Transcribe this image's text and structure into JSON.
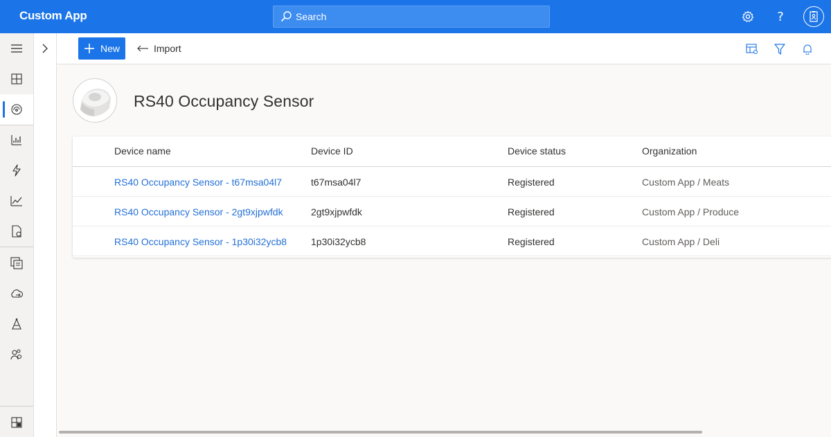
{
  "app": {
    "title": "Custom App"
  },
  "search": {
    "label": "Search"
  },
  "header_icons": [
    "settings-icon",
    "help-icon",
    "account-icon"
  ],
  "nav": {
    "items": [
      "menu-icon",
      "dashboard-icon",
      "devices-icon",
      "device-groups-icon",
      "rules-icon",
      "analytics-icon",
      "jobs-icon",
      "device-templates-icon",
      "data-export-icon",
      "device-connection-icon",
      "users-roles-icon",
      "settings-footer-icon"
    ],
    "active": "devices"
  },
  "toolbar": {
    "new_label": "New",
    "import_label": "Import",
    "right_icons": [
      "edit-columns-icon",
      "filter-icon",
      "notifications-icon"
    ]
  },
  "page": {
    "title": "RS40 Occupancy Sensor"
  },
  "table": {
    "columns": [
      "Device name",
      "Device ID",
      "Device status",
      "Organization"
    ],
    "rows": [
      {
        "name": "RS40 Occupancy Sensor - t67msa04l7",
        "id": "t67msa04l7",
        "status": "Registered",
        "org": "Custom App / Meats"
      },
      {
        "name": "RS40 Occupancy Sensor - 2gt9xjpwfdk",
        "id": "2gt9xjpwfdk",
        "status": "Registered",
        "org": "Custom App / Produce"
      },
      {
        "name": "RS40 Occupancy Sensor - 1p30i32ycb8",
        "id": "1p30i32ycb8",
        "status": "Registered",
        "org": "Custom App / Deli"
      }
    ]
  },
  "colors": {
    "brand": "#1b74e8",
    "link": "#2470d6",
    "rail": "#f3f2f1",
    "background": "#faf9f8"
  }
}
